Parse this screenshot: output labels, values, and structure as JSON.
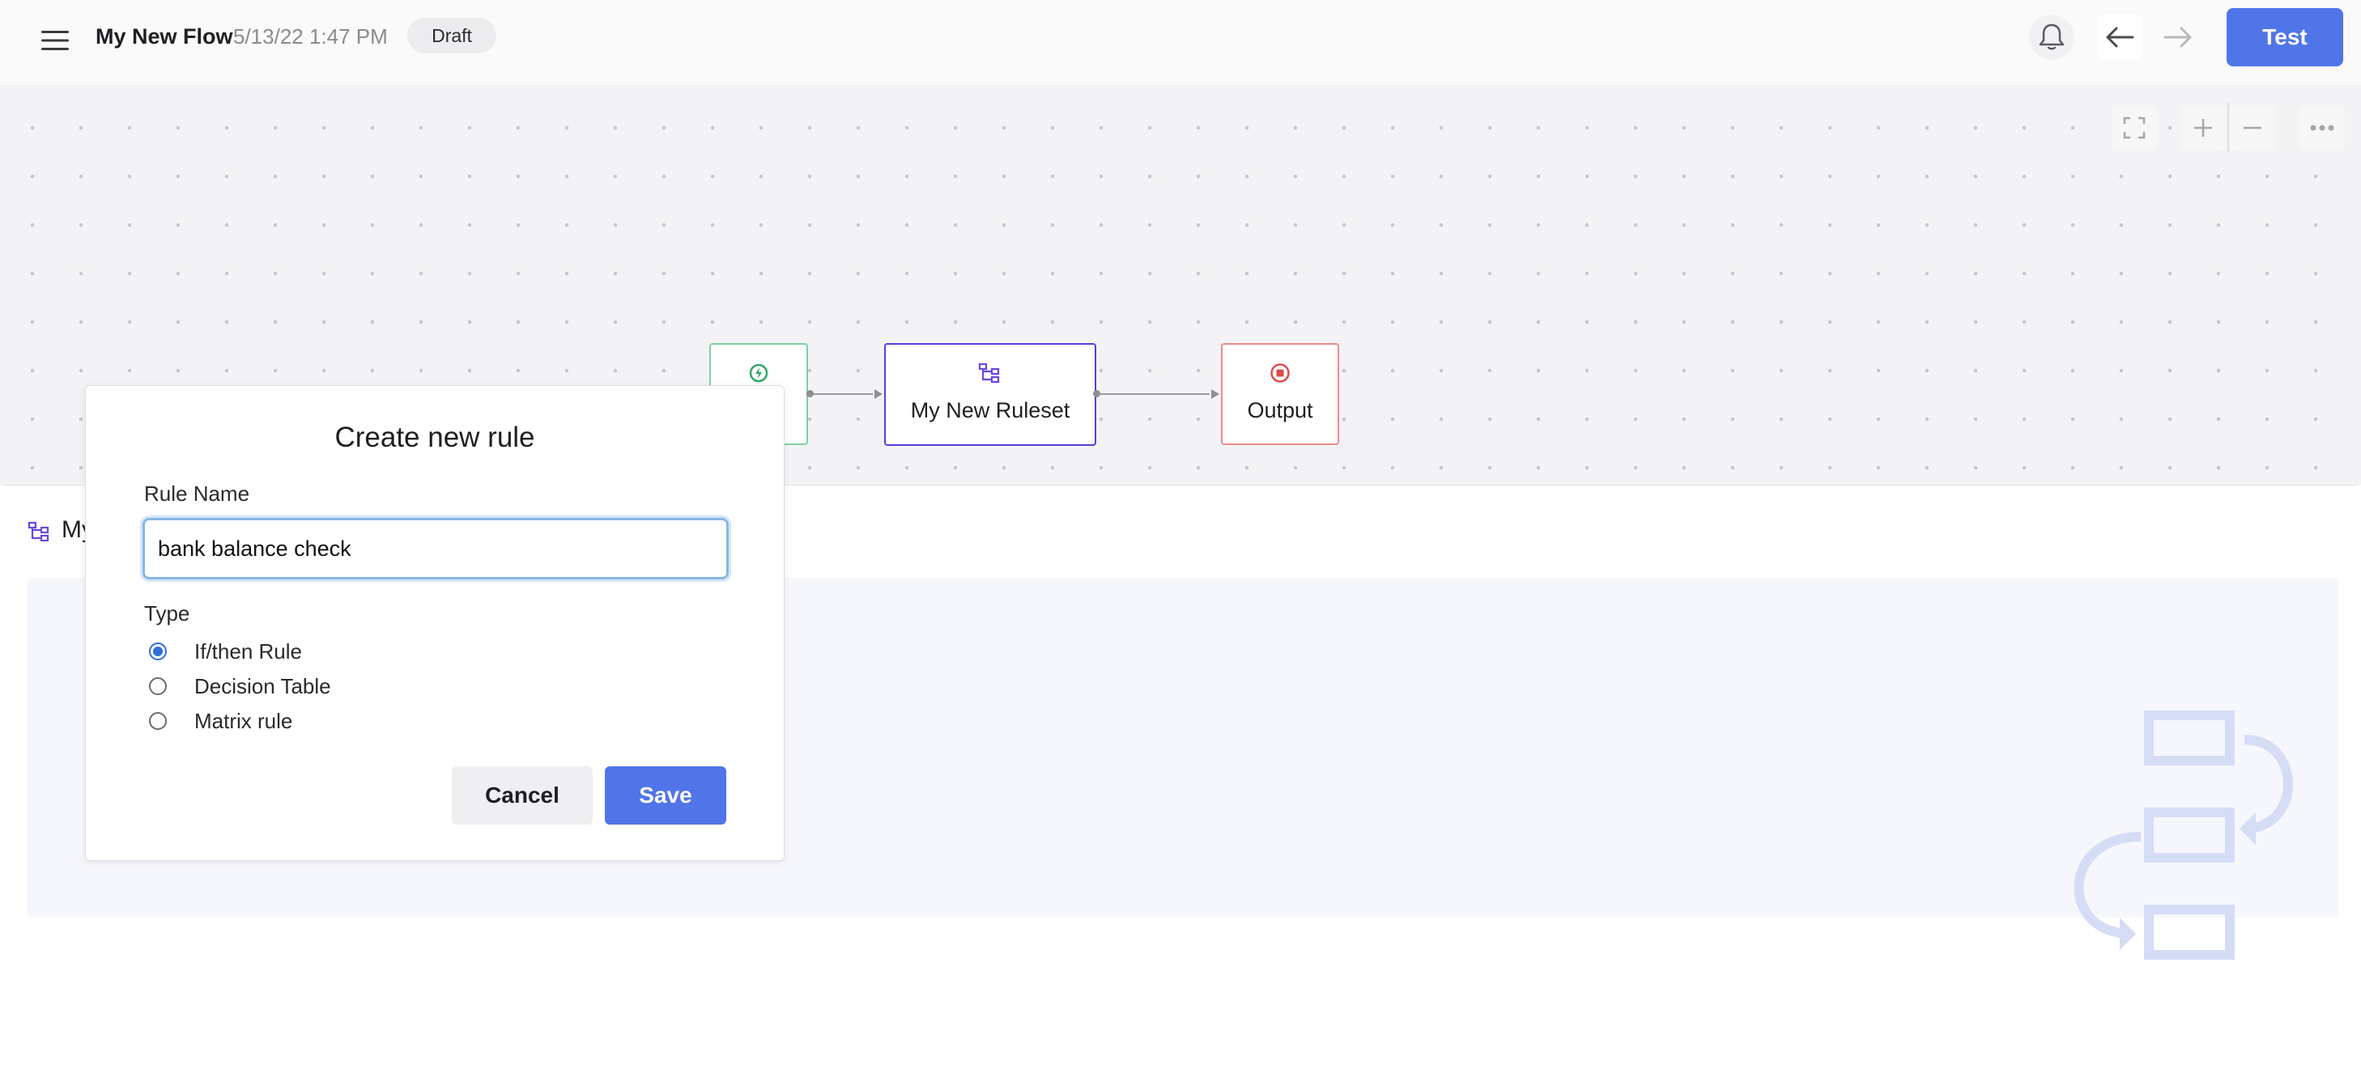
{
  "header": {
    "flow_title": "My New Flow",
    "flow_date": "5/13/22 1:47 PM",
    "status_badge": "Draft",
    "test_label": "Test",
    "icons": [
      "menu-icon",
      "bell-icon",
      "arrow-left-icon",
      "arrow-right-icon"
    ]
  },
  "canvas": {
    "tools": [
      "fullscreen-icon",
      "zoom-in-icon",
      "zoom-out-icon",
      "more-icon"
    ],
    "nodes": [
      {
        "id": "input",
        "label": "",
        "icon": "lightning-icon",
        "color": "#2fa865"
      },
      {
        "id": "ruleset",
        "label": "My New Ruleset",
        "icon": "ruleset-icon",
        "color": "#6a47e0"
      },
      {
        "id": "output",
        "label": "Output",
        "icon": "stop-icon",
        "color": "#e04a4a"
      }
    ]
  },
  "panel": {
    "title": "My New Ruleset",
    "icon": "ruleset-icon"
  },
  "modal": {
    "title": "Create new rule",
    "rule_name_label": "Rule Name",
    "rule_name_value": "bank balance check",
    "type_label": "Type",
    "type_options": [
      {
        "label": "If/then Rule",
        "selected": true
      },
      {
        "label": "Decision Table",
        "selected": false
      },
      {
        "label": "Matrix rule",
        "selected": false
      }
    ],
    "cancel_label": "Cancel",
    "save_label": "Save"
  },
  "colors": {
    "primary": "#4f75e8",
    "accent_purple": "#5b3cdc",
    "success_green": "#2fa865",
    "danger_red": "#e04a4a"
  }
}
